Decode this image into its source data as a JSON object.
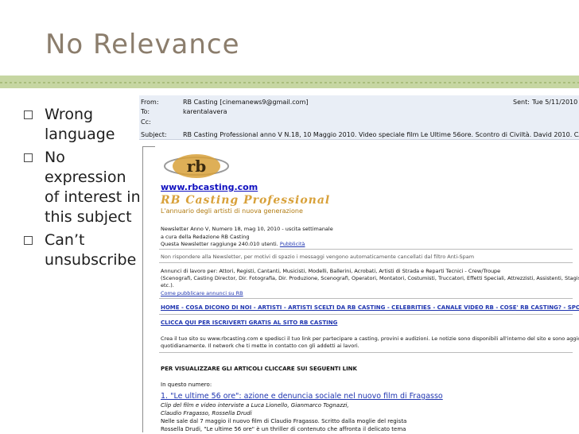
{
  "slide": {
    "title": "No Relevance",
    "bullets": [
      "Wrong language",
      "No expression of interest in this subject",
      "Can’t unsubscribe"
    ]
  },
  "email": {
    "header": {
      "from_label": "From:",
      "from_value": "RB Casting [cinemanews9@gmail.com]",
      "to_label": "To:",
      "to_value": "karentalavera",
      "cc_label": "Cc:",
      "subject_label": "Subject:",
      "subject_value": "RB Casting Professional anno V N.18, 10 Maggio 2010. Video speciale film Le Ultime 56ore. Scontro di Civiltà. David 2010. CASTING CALLS..",
      "sent_label": "Sent:",
      "sent_value": "Tue 5/11/2010 1"
    },
    "body": {
      "logo_text": "rb",
      "site": "www.rbcasting.com",
      "brand_script": "RB Casting Professional",
      "tagline": "L'annuario degli artisti di nuova generazione",
      "newsletter_line": "Newsletter Anno V, Numero 18, mag 10, 2010 - uscita settimanale",
      "redazione": "a cura della Redazione RB Casting",
      "reach": "Questa Newsletter raggiunge 240.010 utenti.",
      "pubblicita": "Pubblicità",
      "no_reply": "Non rispondere alla Newsletter, per motivi di spazio i messaggi vengono automaticamente cancellati dal filtro Anti-Spam",
      "annunci_1": "Annunci di lavoro per: Attori, Registi, Cantanti, Musicisti, Modelli, Ballerini, Acrobati, Artisti di Strada e Reparti Tecnici - Crew/Troupe",
      "annunci_2": "(Scenografi, Casting Director, Dir. Fotografia, Dir. Produzione, Scenografi, Operatori, Montatori, Costumisti, Truccatori, Effetti Speciali, Attrezzisti, Assistenti, Stagisti",
      "annunci_3": "etc.).",
      "come_pubblicare": "Come pubblicare annunci su RB",
      "nav": "HOME - COSA DICONO DI NOI - ARTISTI - ARTISTI SCELTI DA RB CASTING - CELEBRITIES - CANALE VIDEO RB - COSE' RB CASTING? - SPONSOR",
      "iscriviti": "CLICCA QUI PER ISCRIVERTI GRATIS AL SITO RB CASTING",
      "crea_1": "Crea il tuo sito su www.rbcasting.com e spedisci il tuo link per partecipare a casting, provini e audizioni. Le notizie sono disponibili all'interno del sito e sono aggiornate",
      "crea_2": "quotidianamente. Il network che ti mette in contatto con gli addetti ai lavori.",
      "articoli": "PER VISUALIZZARE GLI ARTICOLI CLICCARE SUI SEGUENTI LINK",
      "in_numero": "In questo numero:",
      "article_title": "1. \"Le ultime 56 ore\": azione e denuncia sociale nel nuovo film di Fragasso",
      "article_sub_1": "Clip del film e video interviste a Luca Lionello, Gianmarco Tognazzi,",
      "article_sub_2": "Claudio Fragasso, Rossella Drudi",
      "article_body_1": "Nelle sale dal 7 maggio il nuovo film di Claudio Fragasso. Scritto dalla moglie del regista",
      "article_body_2": "Rossella Drudi, \"Le ultime 56 ore\" è un thriller di contenuto che affronta il delicato tema"
    }
  },
  "colors": {
    "title": "#8b7d6c",
    "rule": "#c6d6a2",
    "header_bg": "#e9eef6",
    "link": "#1f35b0",
    "brand_gold": "#d8a13a"
  }
}
